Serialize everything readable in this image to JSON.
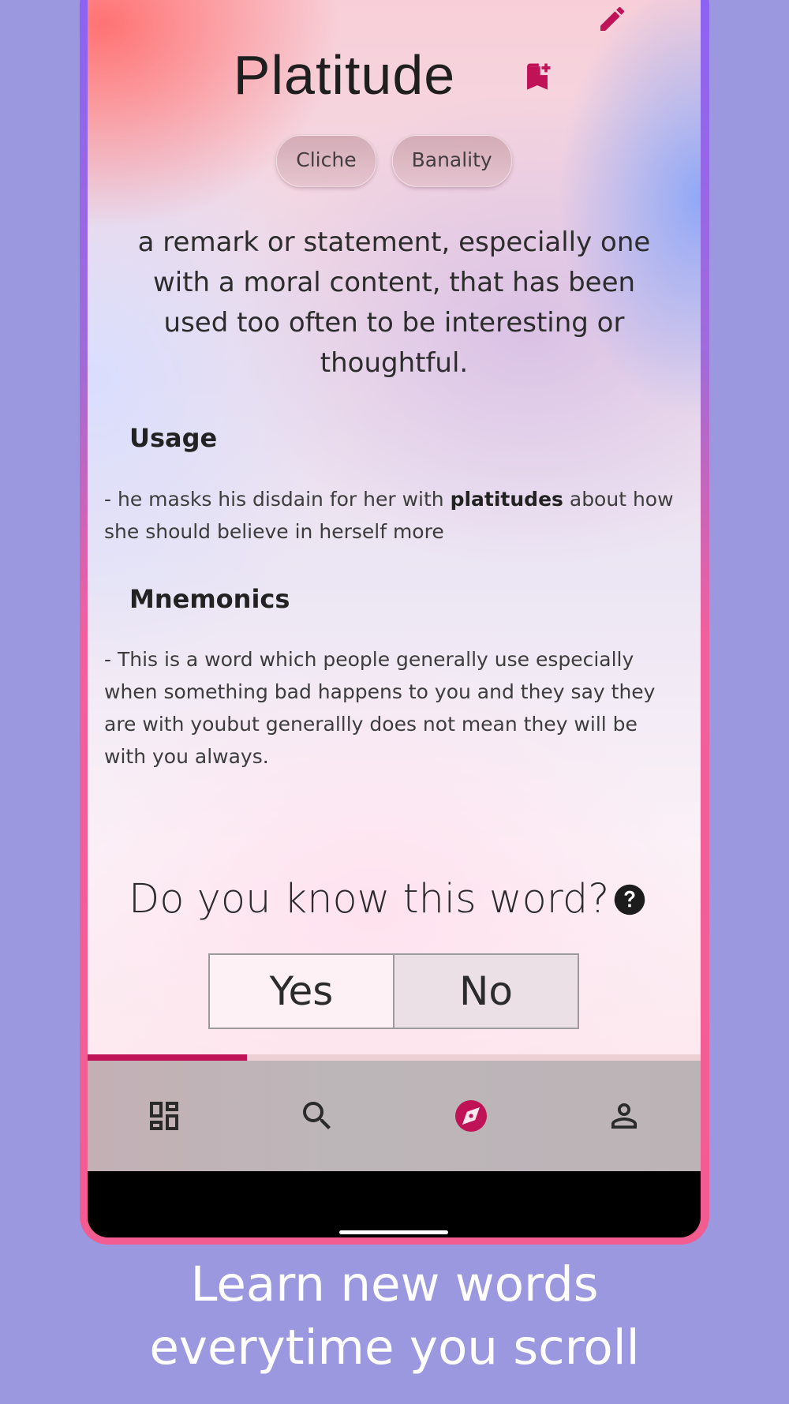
{
  "word": {
    "title": "Platitude",
    "synonyms": [
      "Cliche",
      "Banality"
    ],
    "definition": "a remark or statement, especially one with a moral content, that has been used too often to be interesting or thoughtful."
  },
  "usage": {
    "heading": "Usage",
    "prefix": " - he masks his disdain for her with ",
    "highlight": "platitudes",
    "suffix": " about how she should believe in herself more"
  },
  "mnemonics": {
    "heading": "Mnemonics",
    "text": " - This is a word which people generally use especially when something bad happens to you and they say they are with youbut generallly does not mean they will be with you always."
  },
  "quiz": {
    "question": "Do you know this word?",
    "yes_label": "Yes",
    "no_label": "No"
  },
  "progress": {
    "fraction": 0.26
  },
  "nav": {
    "items": [
      {
        "name": "dashboard",
        "icon": "dashboard-icon",
        "active": false
      },
      {
        "name": "search",
        "icon": "search-icon",
        "active": false
      },
      {
        "name": "explore",
        "icon": "compass-icon",
        "active": true
      },
      {
        "name": "profile",
        "icon": "person-icon",
        "active": false
      }
    ]
  },
  "tagline": {
    "line1": "Learn new words",
    "line2": "everytime you scroll"
  },
  "colors": {
    "accent": "#c01357",
    "background": "#9b98e0",
    "frame": "#f35c91"
  }
}
